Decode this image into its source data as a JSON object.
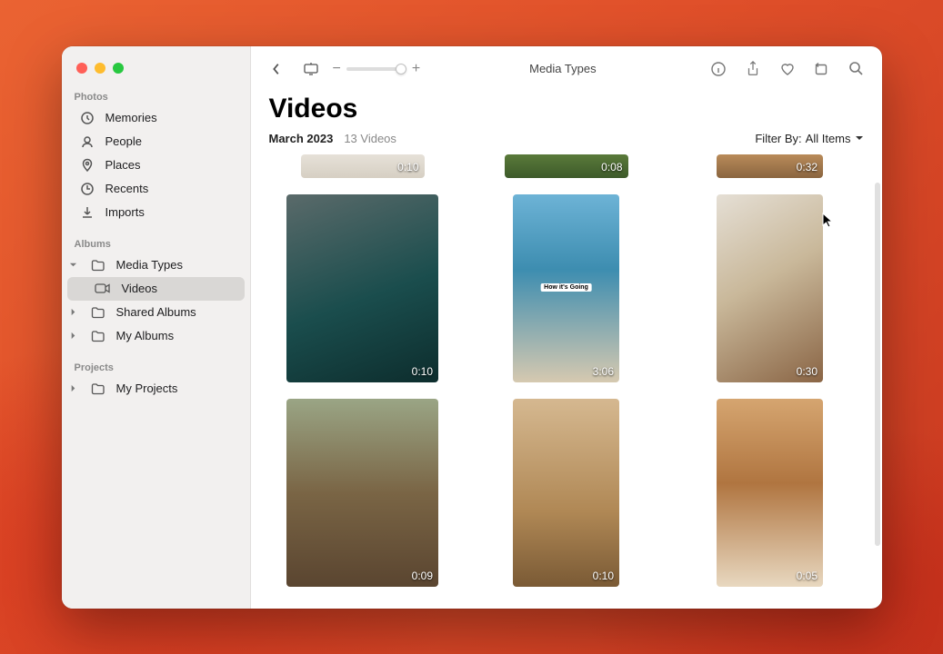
{
  "window_title": "Media Types",
  "sidebar": {
    "sections": [
      {
        "header": "Photos",
        "items": [
          {
            "label": "Memories",
            "icon": "memories"
          },
          {
            "label": "People",
            "icon": "people"
          },
          {
            "label": "Places",
            "icon": "places"
          },
          {
            "label": "Recents",
            "icon": "recents"
          },
          {
            "label": "Imports",
            "icon": "imports"
          }
        ]
      },
      {
        "header": "Albums",
        "items": [
          {
            "label": "Media Types",
            "icon": "folder",
            "expanded": true,
            "children": [
              {
                "label": "Videos",
                "icon": "video",
                "selected": true
              }
            ]
          },
          {
            "label": "Shared Albums",
            "icon": "folder"
          },
          {
            "label": "My Albums",
            "icon": "folder"
          }
        ]
      },
      {
        "header": "Projects",
        "items": [
          {
            "label": "My Projects",
            "icon": "folder"
          }
        ]
      }
    ]
  },
  "main": {
    "title": "Videos",
    "date": "March 2023",
    "count": "13 Videos",
    "filter_label": "Filter By:",
    "filter_value": "All Items"
  },
  "videos": {
    "partial": [
      {
        "duration": "0:10",
        "bg": "linear-gradient(#e6e1d8,#d6cfc3)"
      },
      {
        "duration": "0:08",
        "bg": "linear-gradient(#5a7a3a,#3d5a2a)"
      },
      {
        "duration": "0:32",
        "bg": "linear-gradient(#b98b5a,#8a6540)"
      }
    ],
    "full": [
      {
        "duration": "0:10",
        "bg": "linear-gradient(160deg,#5a6a6a 0%,#1a4d4d 55%,#0d2d2d 100%)"
      },
      {
        "duration": "3:06",
        "bg": "linear-gradient(#6db3d6 0%,#3d8db0 40%,#d6c9b0 100%)",
        "caption": "How it's Going"
      },
      {
        "duration": "0:30",
        "bg": "linear-gradient(150deg,#e5dfd5 0%,#c9b89a 45%,#8a6545 100%)"
      },
      {
        "duration": "0:09",
        "bg": "linear-gradient(#9aa585 0%,#7a6545 50%,#5a4530 100%)"
      },
      {
        "duration": "0:10",
        "bg": "linear-gradient(#d5b890 0%,#b08855 60%,#7a5a35 100%)"
      },
      {
        "duration": "0:05",
        "bg": "linear-gradient(#d5a570 0%,#b07540 45%,#e8d8c0 100%)"
      }
    ]
  }
}
